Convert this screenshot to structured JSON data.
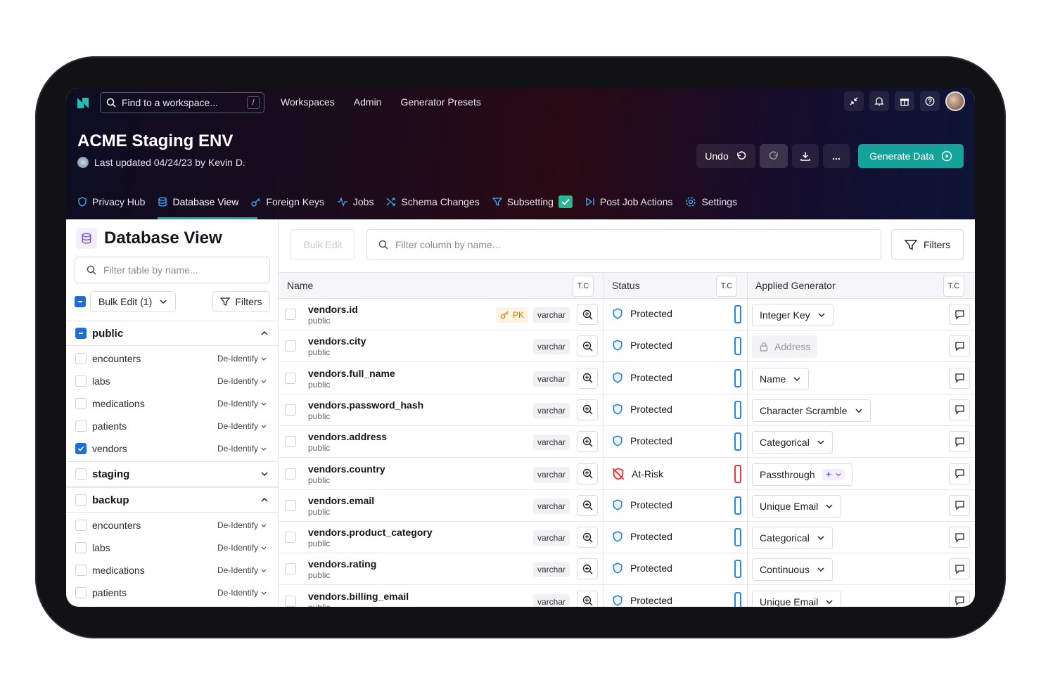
{
  "header": {
    "search_placeholder": "Find to a workspace...",
    "search_shortcut": "/",
    "nav": [
      "Workspaces",
      "Admin",
      "Generator Presets"
    ],
    "env_title": "ACME Staging ENV",
    "last_updated": "Last updated 04/24/23 by Kevin D.",
    "undo_label": "Undo",
    "more_label": "...",
    "generate_label": "Generate Data",
    "tabs": [
      "Privacy Hub",
      "Database View",
      "Foreign Keys",
      "Jobs",
      "Schema Changes",
      "Subsetting",
      "Post Job Actions",
      "Settings"
    ],
    "active_tab": "Database View",
    "accent": "#14a39a"
  },
  "left_panel": {
    "title": "Database View",
    "filter_placeholder": "Filter table by name...",
    "bulk_edit_label": "Bulk Edit (1)",
    "filters_label": "Filters",
    "schemas": [
      {
        "name": "public",
        "expanded": true,
        "tables": [
          {
            "name": "encounters",
            "mode": "De-Identify",
            "checked": false
          },
          {
            "name": "labs",
            "mode": "De-Identify",
            "checked": false
          },
          {
            "name": "medications",
            "mode": "De-Identify",
            "checked": false
          },
          {
            "name": "patients",
            "mode": "De-Identify",
            "checked": false
          },
          {
            "name": "vendors",
            "mode": "De-Identify",
            "checked": true
          }
        ]
      },
      {
        "name": "staging",
        "expanded": false,
        "tables": []
      },
      {
        "name": "backup",
        "expanded": true,
        "tables": [
          {
            "name": "encounters",
            "mode": "De-Identify",
            "checked": false
          },
          {
            "name": "labs",
            "mode": "De-Identify",
            "checked": false
          },
          {
            "name": "medications",
            "mode": "De-Identify",
            "checked": false
          },
          {
            "name": "patients",
            "mode": "De-Identify",
            "checked": false
          }
        ]
      }
    ]
  },
  "right_panel": {
    "bulk_edit_label": "Bulk Edit",
    "filter_placeholder": "Filter column by name...",
    "filters_label": "Filters",
    "columns": {
      "name": "Name",
      "status": "Status",
      "generator": "Applied Generator",
      "tc": "T.C"
    },
    "rows": [
      {
        "name": "vendors.id",
        "schema": "public",
        "pk": "PK",
        "type": "varchar",
        "status": "Protected",
        "generator": "Integer Key"
      },
      {
        "name": "vendors.city",
        "schema": "public",
        "type": "varchar",
        "status": "Protected",
        "generator": "Address",
        "locked": true
      },
      {
        "name": "vendors.full_name",
        "schema": "public",
        "type": "varchar",
        "status": "Protected",
        "generator": "Name"
      },
      {
        "name": "vendors.password_hash",
        "schema": "public",
        "type": "varchar",
        "status": "Protected",
        "generator": "Character Scramble"
      },
      {
        "name": "vendors.address",
        "schema": "public",
        "type": "varchar",
        "status": "Protected",
        "generator": "Categorical"
      },
      {
        "name": "vendors.country",
        "schema": "public",
        "type": "varchar",
        "status": "At-Risk",
        "generator": "Passthrough",
        "suggest": true
      },
      {
        "name": "vendors.email",
        "schema": "public",
        "type": "varchar",
        "status": "Protected",
        "generator": "Unique Email"
      },
      {
        "name": "vendors.product_category",
        "schema": "public",
        "type": "varchar",
        "status": "Protected",
        "generator": "Categorical"
      },
      {
        "name": "vendors.rating",
        "schema": "public",
        "type": "varchar",
        "status": "Protected",
        "generator": "Continuous"
      },
      {
        "name": "vendors.billing_email",
        "schema": "public",
        "type": "varchar",
        "status": "Protected",
        "generator": "Unique Email"
      }
    ],
    "protected_color": "#2b82e0",
    "at_risk_color": "#e03a3a"
  }
}
